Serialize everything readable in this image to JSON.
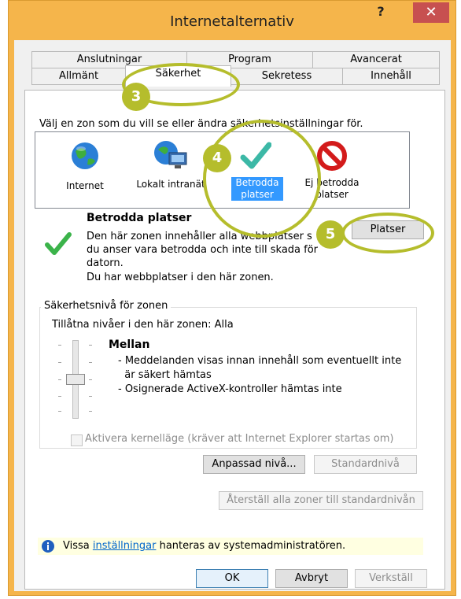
{
  "window": {
    "title": "Internetalternativ",
    "help_symbol": "?",
    "close_symbol": "✕"
  },
  "tabs": {
    "row1": [
      "Anslutningar",
      "Program",
      "Avancerat"
    ],
    "row2": [
      "Allmänt",
      "Säkerhet",
      "Sekretess",
      "Innehåll"
    ],
    "active": "Säkerhet"
  },
  "security": {
    "zone_prompt": "Välj en zon som du vill se eller ändra säkerhetsinställningar för.",
    "zones": [
      {
        "name": "Internet",
        "icon": "globe-icon"
      },
      {
        "name": "Lokalt intranät",
        "icon": "intranet-icon"
      },
      {
        "name": "Betrodda platser",
        "icon": "checkmark-icon"
      },
      {
        "name": "Ej betrodda platser",
        "icon": "forbidden-icon"
      }
    ],
    "selected_zone": "Betrodda platser",
    "zone_heading": "Betrodda platser",
    "zone_description_lines": [
      "Den här zonen innehåller alla webbplatser s",
      "du anser vara betrodda och inte till skada för",
      "datorn.",
      "Du har webbplatser i den här zonen."
    ],
    "sites_button": "Platser",
    "level_group_label": "Säkerhetsnivå för zonen",
    "allowed_levels": "Tillåtna nivåer i den här zonen: Alla",
    "level_name": "Mellan",
    "level_desc_lines": [
      "- Meddelanden visas innan innehåll som eventuellt inte",
      "  är säkert hämtas",
      "- Osignerade ActiveX-kontroller hämtas inte"
    ],
    "protected_mode_label": "Aktivera kernelläge (kräver att Internet Explorer startas om)",
    "custom_level_button": "Anpassad nivå...",
    "default_level_button": "Standardnivå",
    "reset_all_button": "Återställ alla zoner till standardnivån"
  },
  "info_bar": {
    "pre": "Vissa ",
    "link": "inställningar",
    "post": " hanteras av systemadministratören."
  },
  "footer": {
    "ok": "OK",
    "cancel": "Avbryt",
    "apply": "Verkställ"
  },
  "annotations": [
    "3",
    "4",
    "5"
  ],
  "colors": {
    "window_frame": "#f5b54b",
    "close_button": "#c75050",
    "annotation": "#b5bd2c",
    "selection": "#3399ff"
  }
}
